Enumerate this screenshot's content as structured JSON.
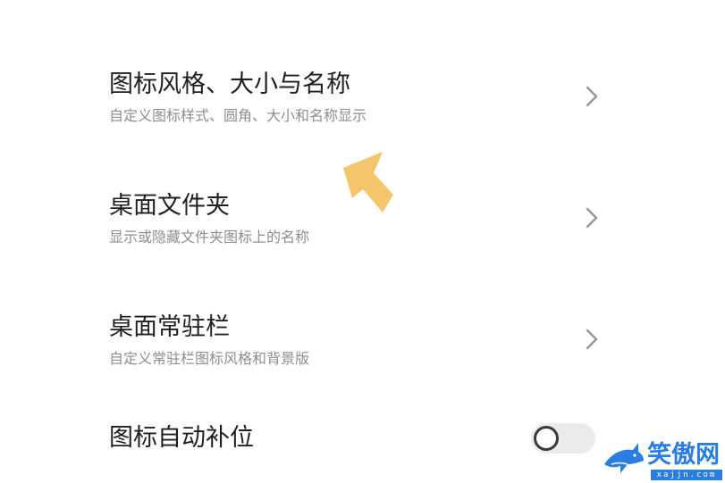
{
  "settings": {
    "rows": [
      {
        "title": "图标风格、大小与名称",
        "subtitle": "自定义图标样式、圆角、大小和名称显示",
        "control": "chevron-right-icon"
      },
      {
        "title": "桌面文件夹",
        "subtitle": "显示或隐藏文件夹图标上的名称",
        "control": "chevron-right-icon"
      },
      {
        "title": "桌面常驻栏",
        "subtitle": "自定义常驻栏图标风格和背景版",
        "control": "chevron-right-icon"
      },
      {
        "title": "图标自动补位",
        "control": "toggle",
        "toggle_on": false
      }
    ]
  },
  "annotation": {
    "icon": "arrow-up-left-icon",
    "color": "#F5C56B"
  },
  "watermark": {
    "text": "笑傲网",
    "url": "xajjn.com",
    "icon": "shark-logo-icon",
    "color": "#2A7DE1"
  },
  "colors": {
    "title": "#1F1F1F",
    "subtitle": "#8E8E8E",
    "chevron": "#9A9A9A",
    "toggle_track": "#EBEBEB"
  }
}
